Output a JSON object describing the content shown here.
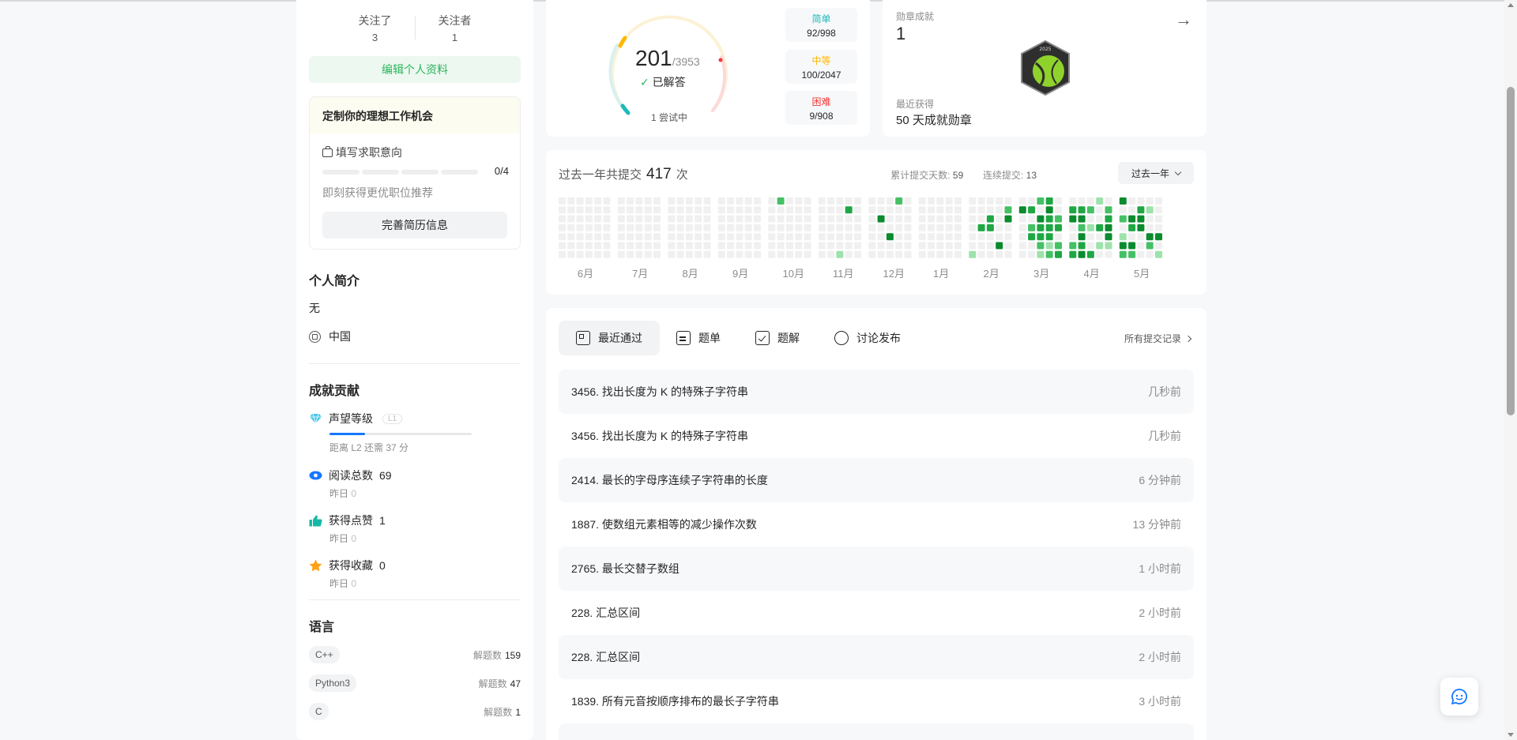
{
  "profile": {
    "following_label": "关注了",
    "following_count": "3",
    "followers_label": "关注者",
    "followers_count": "1",
    "edit_button": "编辑个人资料"
  },
  "job": {
    "title": "定制你的理想工作机会",
    "fill_intent": "填写求职意向",
    "progress_text": "0/4",
    "progress_fraction": 0,
    "subtitle": "即刻获得更优职位推荐",
    "resume_button": "完善简历信息"
  },
  "bio": {
    "title": "个人简介",
    "text": "无",
    "location": "中国"
  },
  "achievements": {
    "title": "成就贡献",
    "reputation_label": "声望等级",
    "reputation_level": "L1",
    "reputation_progress": 0.25,
    "reputation_sub": "距离 L2 还需 37 分",
    "reads_label": "阅读总数",
    "reads_value": "69",
    "reads_yesterday_label": "昨日",
    "reads_yesterday": "0",
    "likes_label": "获得点赞",
    "likes_value": "1",
    "likes_yesterday_label": "昨日",
    "likes_yesterday": "0",
    "favs_label": "获得收藏",
    "favs_value": "0",
    "favs_yesterday_label": "昨日",
    "favs_yesterday": "0"
  },
  "languages": {
    "title": "语言",
    "count_label": "解题数",
    "items": [
      {
        "name": "C++",
        "count": "159"
      },
      {
        "name": "Python3",
        "count": "47"
      },
      {
        "name": "C",
        "count": "1"
      }
    ]
  },
  "stats": {
    "solved": "201",
    "total": "/3953",
    "solved_label": "已解答",
    "attempting": "1 尝试中",
    "easy_label": "简单",
    "easy_value": "92/998",
    "medium_label": "中等",
    "medium_value": "100/2047",
    "hard_label": "困难",
    "hard_value": "9/908",
    "colors": {
      "easy": "#1cbaba",
      "medium": "#ffb700",
      "hard": "#f63737"
    }
  },
  "badges": {
    "title": "勋章成就",
    "count": "1",
    "recent_label": "最近获得",
    "recent_name": "50 天成就勋章",
    "badge_text": "2025"
  },
  "heatmap": {
    "prefix": "过去一年共提交",
    "total": "417",
    "suffix": "次",
    "active_days_label": "累计提交天数:",
    "active_days": "59",
    "streak_label": "连续提交:",
    "streak": "13",
    "range_select": "过去一年",
    "months": [
      "6月",
      "7月",
      "8月",
      "9月",
      "10月",
      "11月",
      "12月",
      "1月",
      "2月",
      "3月",
      "4月",
      "5月"
    ]
  },
  "recent": {
    "tabs": [
      {
        "label": "最近通过",
        "icon": "checklist-icon"
      },
      {
        "label": "题单",
        "icon": "document-icon"
      },
      {
        "label": "题解",
        "icon": "check-square-icon"
      },
      {
        "label": "讨论发布",
        "icon": "discussion-icon"
      }
    ],
    "all_link": "所有提交记录",
    "items": [
      {
        "title": "3456. 找出长度为 K 的特殊子字符串",
        "time": "几秒前"
      },
      {
        "title": "3456. 找出长度为 K 的特殊子字符串",
        "time": "几秒前"
      },
      {
        "title": "2414. 最长的字母序连续子字符串的长度",
        "time": "6 分钟前"
      },
      {
        "title": "1887. 使数组元素相等的减少操作次数",
        "time": "13 分钟前"
      },
      {
        "title": "2765. 最长交替子数组",
        "time": "1 小时前"
      },
      {
        "title": "228. 汇总区间",
        "time": "2 小时前"
      },
      {
        "title": "228. 汇总区间",
        "time": "2 小时前"
      },
      {
        "title": "1839. 所有元音按顺序排布的最长子字符串",
        "time": "3 小时前"
      }
    ]
  }
}
